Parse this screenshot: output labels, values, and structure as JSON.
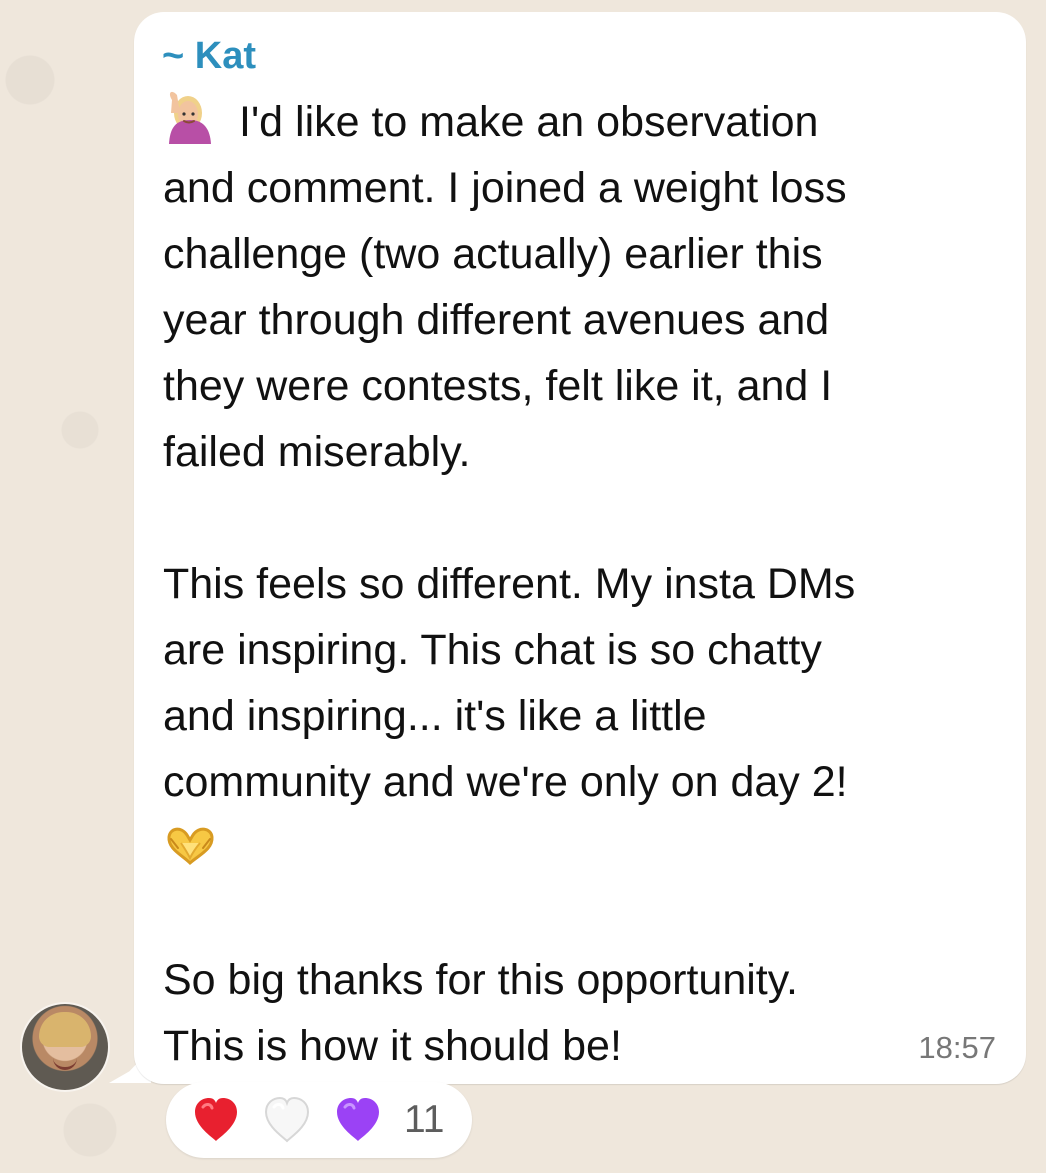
{
  "message": {
    "sender": "~ Kat",
    "text_paragraph_1": "I'd like to make an observation\nand comment. I joined a weight loss\nchallenge (two actually) earlier this\nyear through different avenues and\nthey were contests, felt like it, and I\nfailed miserably.",
    "text_paragraph_2": "This feels so different. My insta DMs\nare inspiring. This chat is so chatty\nand inspiring... it's like a little\ncommunity and we're only on day 2!",
    "text_paragraph_3": "So big thanks for this opportunity.\nThis is how it should be!",
    "time": "18:57",
    "leading_emoji": "raising-hand-emoji",
    "heart_hands_emoji": "heart-hands-emoji"
  },
  "reactions": {
    "items": [
      {
        "icon": "red-heart-icon",
        "color": "#e8202f"
      },
      {
        "icon": "white-heart-icon",
        "color": "#ffffff"
      },
      {
        "icon": "purple-heart-icon",
        "color": "#9b42f5"
      }
    ],
    "count": "11"
  },
  "colors": {
    "sender": "#2d8fbd",
    "background": "#efe7dc",
    "bubble": "#ffffff"
  }
}
